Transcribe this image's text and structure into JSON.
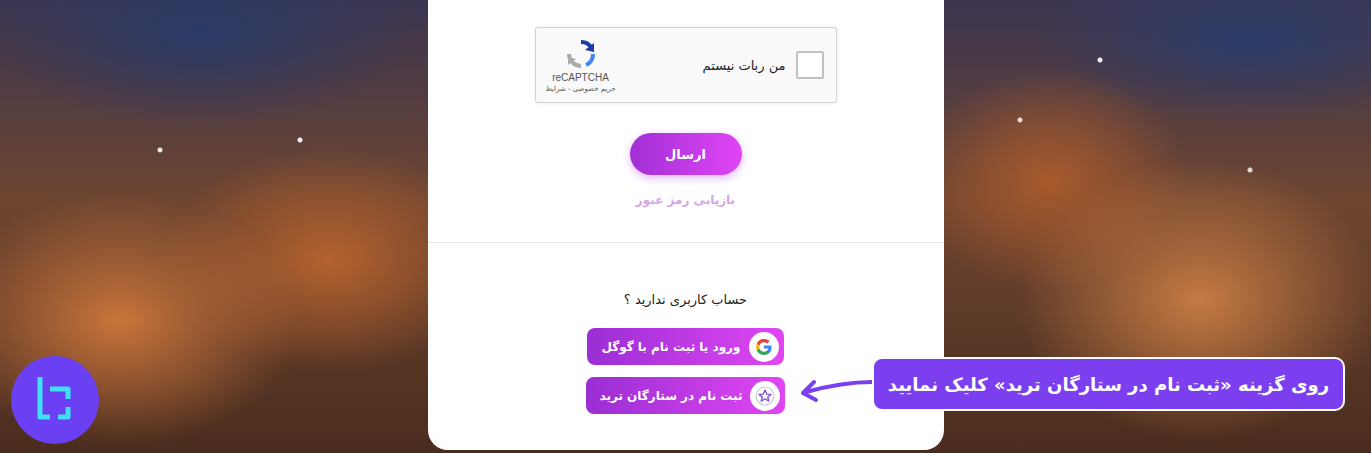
{
  "recaptcha": {
    "label": "من ربات نیستم",
    "checked": false,
    "brand": "reCAPTCHA",
    "links": "حریم خصوصی - شرایط"
  },
  "submit": {
    "label": "ارسال"
  },
  "forgot": {
    "label": "بازیابی رمز عبور"
  },
  "signup_prompt": "حساب کاربری ندارید ؟",
  "social_buttons": [
    {
      "label": "ورود یا ثبت نام با گوگل",
      "kind": "google"
    },
    {
      "label": "ثبت نام در ستارگان ترید",
      "kind": "register"
    }
  ],
  "callout": {
    "text": "روی گزینه «ثبت نام در ستارگان ترید» کلیک نمایید"
  }
}
